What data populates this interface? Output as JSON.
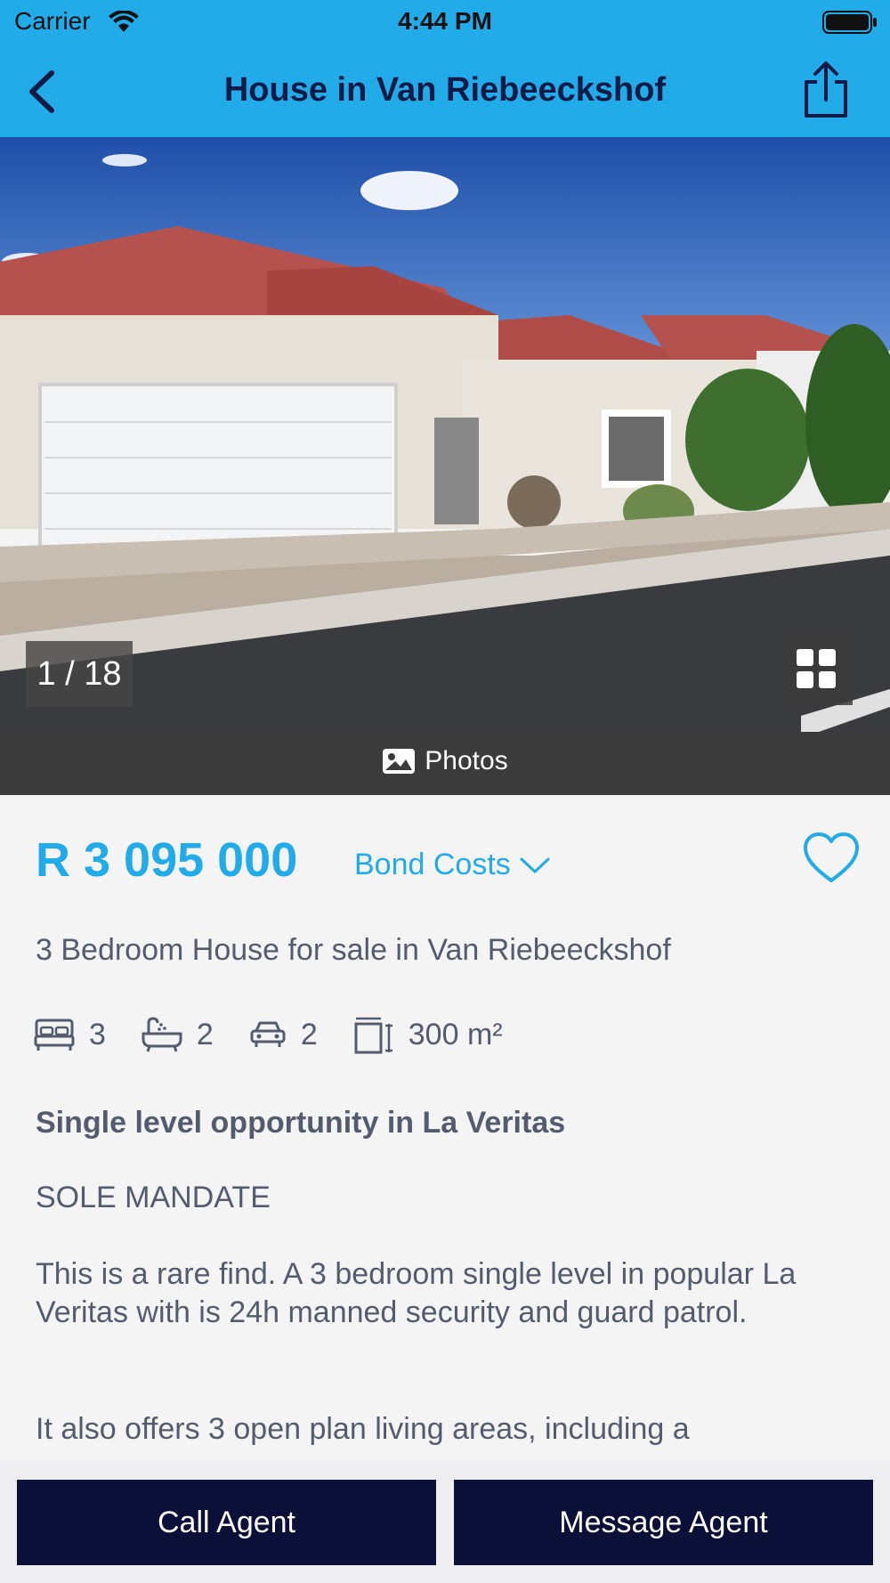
{
  "status_bar": {
    "carrier": "Carrier",
    "time": "4:44 PM"
  },
  "nav": {
    "title": "House in Van Riebeeckshof"
  },
  "gallery": {
    "counter": "1 / 18",
    "photos_label": "Photos"
  },
  "listing": {
    "price": "R 3 095 000",
    "bond_costs_label": "Bond Costs",
    "subtitle": "3 Bedroom House for sale in Van Riebeeckshof",
    "features": {
      "bedrooms": "3",
      "bathrooms": "2",
      "garages": "2",
      "size": "300 m²"
    },
    "heading": "Single level opportunity in La Veritas",
    "mandate": "SOLE MANDATE",
    "paragraph1": "This is a rare find.  A 3 bedroom single level in popular La Veritas with is 24h manned security and guard patrol.",
    "paragraph2": "It also offers 3 open plan living areas, including a"
  },
  "actions": {
    "call": "Call Agent",
    "message": "Message Agent"
  },
  "colors": {
    "accent": "#21abe8",
    "title": "#0f1b47",
    "button": "#0b1038"
  }
}
